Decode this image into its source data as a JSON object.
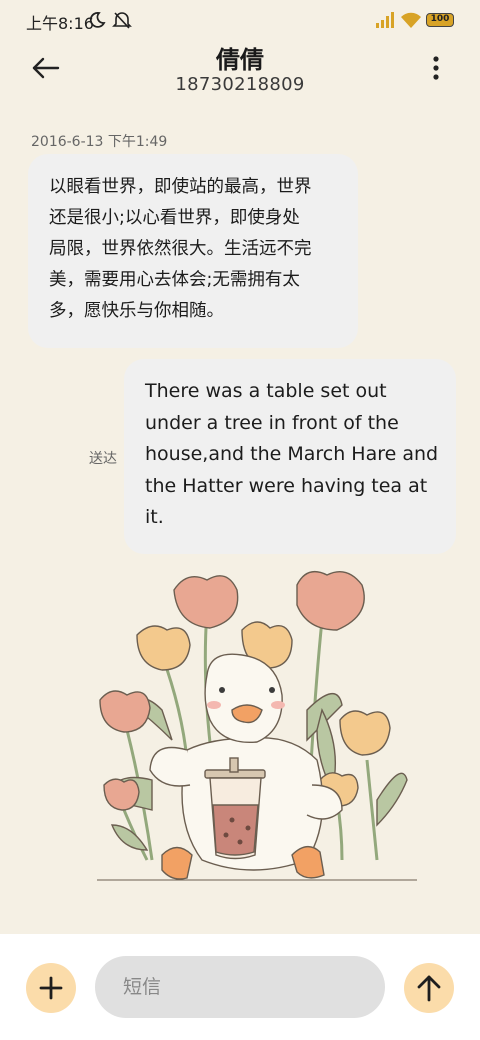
{
  "status_bar": {
    "time": "上午8:16",
    "battery": "100",
    "icons": [
      "moon-icon",
      "mute-icon",
      "signal-icon",
      "wifi-icon",
      "battery-icon"
    ]
  },
  "header": {
    "contact_name": "倩倩",
    "phone": "18730218809",
    "icons": [
      "back-arrow-icon",
      "more-vertical-icon"
    ]
  },
  "messages": [
    {
      "direction": "incoming",
      "timestamp": "2016-6-13 下午1:49",
      "lines": [
        "以眼看世界，即使站的最高，世界",
        "还是很小;以心看世界，即使身处",
        "局限，世界依然很大。生活远不完",
        "美，需要用心去体会;无需拥有太",
        "多，愿快乐与你相随。"
      ]
    },
    {
      "direction": "outgoing",
      "status": "送达",
      "lines": [
        "There was a table set out",
        "under a tree in front of the",
        "house,and the March Hare and",
        "the Hatter were having tea at",
        "it."
      ]
    }
  ],
  "composer": {
    "placeholder": "短信",
    "icons": [
      "plus-icon",
      "send-arrow-icon"
    ],
    "button_color": "#fbdcaa"
  },
  "theme": {
    "background": "#f5f0e4",
    "bubble": "#f0f0f0",
    "accent": "#fbdcaa"
  }
}
